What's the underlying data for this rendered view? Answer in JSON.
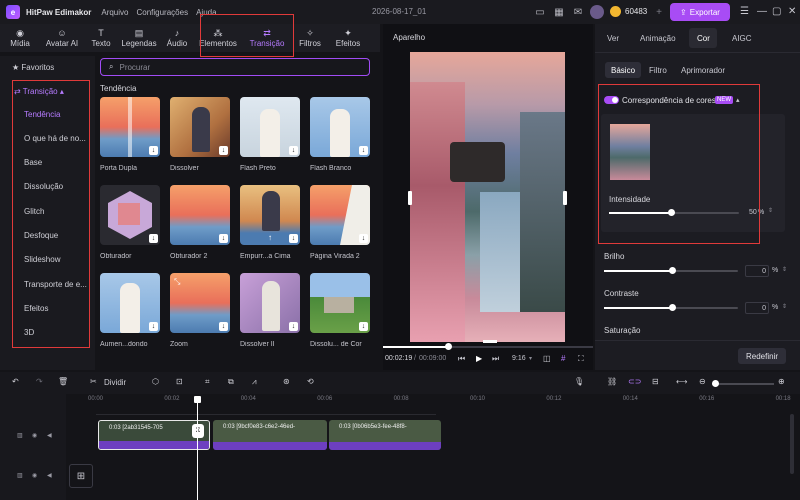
{
  "titlebar": {
    "app_name": "HitPaw Edimakor",
    "menus": [
      "Arquivo",
      "Configurações",
      "Ajuda"
    ],
    "doc_title": "2026-08-17_01",
    "coins": "60483",
    "export_label": "Exportar"
  },
  "toolbar": {
    "tools": [
      "Mídia",
      "Avatar AI",
      "Texto",
      "Legendas",
      "Áudio",
      "Elementos",
      "Transição",
      "Filtros",
      "Efeitos"
    ]
  },
  "sidebar": {
    "favorites": "Favoritos",
    "section": "Transição",
    "items": [
      "Tendência",
      "O que há de no...",
      "Base",
      "Dissolução",
      "Glitch",
      "Desfoque",
      "Slideshow",
      "Transporte de e...",
      "Efeitos",
      "3D"
    ]
  },
  "search": {
    "placeholder": "Procurar"
  },
  "gallery": {
    "heading": "Tendência",
    "items": [
      "Porta Dupla",
      "Dissolver",
      "Flash Preto",
      "Flash Branco",
      "Obturador",
      "Obturador 2",
      "Empurr...a Cima",
      "Página Virada 2",
      "Aumen...dondo",
      "Zoom",
      "Dissolver II",
      "Dissolu... de Cor"
    ]
  },
  "preview": {
    "title": "Aparelho",
    "current_time": "00:02:19",
    "total_time": "00:09:00",
    "aspect": "9:16"
  },
  "right_panel": {
    "tabs": [
      "Ver",
      "Animação",
      "Cor",
      "AIGC"
    ],
    "subtabs": [
      "Básico",
      "Filtro",
      "Aprimorador"
    ],
    "color_match": "Correspondência de cores",
    "new_badge": "NEW",
    "intensity_label": "Intensidade",
    "intensity_value": "50",
    "intensity_unit": "%",
    "brightness_label": "Brilho",
    "brightness_value": "0",
    "contrast_label": "Contraste",
    "contrast_value": "0",
    "saturation_label": "Saturação",
    "reset_label": "Redefinir",
    "pct": "%"
  },
  "timeline_toolbar": {
    "split_label": "Dividir"
  },
  "timeline": {
    "ticks": [
      "00:00",
      "00:02",
      "00:04",
      "00:06",
      "00:08",
      "00:10",
      "00:12",
      "00:14",
      "00:16",
      "00:18"
    ],
    "clips": [
      {
        "name": "0:03 [2ab31545-705"
      },
      {
        "name": "0:03 [9bcf0e83-c6e2-46ed-"
      },
      {
        "name": "0:03 [0b06b5e3-fee-48f8-"
      }
    ]
  },
  "colors": {
    "accent": "#a84cf5",
    "highlight_box": "#e03a3a",
    "clip_purple": "#6d3fc0"
  }
}
